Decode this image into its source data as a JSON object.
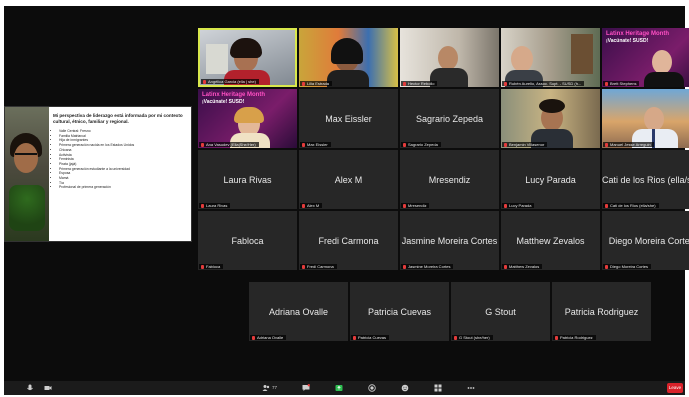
{
  "meeting": {
    "shared_slide": {
      "title": "Mi perspectiva de liderazgo está informada por mi contexto cultural, étnico, familiar y regional.",
      "bullets": [
        "Valle Central: Fresno",
        "Familia Matriarcal",
        "Hija de inmigrantes",
        "Primera generación nacida en los Estados Unidos",
        "Chicana",
        "Activista",
        "Feminista",
        "Pirata (jajá)",
        "Primera generación estudiante a la universidad",
        "Esposa",
        "Mamá",
        "Tía",
        "Profesional de primera generación"
      ]
    },
    "participants": [
      {
        "name": "Angélica Garcia (ella | she)",
        "video": true
      },
      {
        "name": "Lilia Estrada",
        "video": true
      },
      {
        "name": "Hector Rebollo",
        "video": true
      },
      {
        "name": "Rubén Aurelio, Assoc. Supt. - SUSD (h...",
        "video": true
      },
      {
        "name": "Brett Stephens",
        "video": true,
        "banner": "Latinx Heritage Month",
        "banner2": "¡Vacúnate! SUSD!"
      },
      {
        "name": "Ana Vasudev (Ella|She/Her)",
        "video": true,
        "banner": "Latinx Heritage Month",
        "banner2": "¡Vacúnate! SUSD!"
      },
      {
        "name": "Max Eissler",
        "video": false
      },
      {
        "name": "Sagrario Zepeda",
        "video": false
      },
      {
        "name": "Benjamin Villasenor",
        "video": true
      },
      {
        "name": "Manuel Jesse Arreguin",
        "video": true
      },
      {
        "name": "Laura Rivas",
        "video": false
      },
      {
        "name": "Alex M",
        "video": false
      },
      {
        "name": "Mresendiz",
        "video": false
      },
      {
        "name": "Lucy Parada",
        "video": false
      },
      {
        "name": "Cati de los Rios (ella/she/her)",
        "display": "Cati de los Rios (ella/she",
        "label": "Cati de los Rios (ella/she)",
        "video": false
      },
      {
        "name": "Fabloca",
        "video": false
      },
      {
        "name": "Fredi Carmona",
        "video": false
      },
      {
        "name": "Jasmine Moreira Cortes",
        "video": false
      },
      {
        "name": "Matthew Zevalos",
        "video": false
      },
      {
        "name": "Diego Moreira Cortes",
        "video": false
      },
      {
        "name": "Adriana Ovalle",
        "video": false
      },
      {
        "name": "Patricia Cuevas",
        "video": false
      },
      {
        "name": "G Stout",
        "label": "G Stout (she/her)",
        "video": false
      },
      {
        "name": "Patricia Rodriguez",
        "video": false
      }
    ],
    "toolbar": {
      "participant_count": "77",
      "end_label": "Leave"
    },
    "colors": {
      "speaking_border": "#d9e84c",
      "muted_mic": "#e43b3b",
      "end_button": "#d9222a",
      "banner_pink": "#ff4fc4"
    }
  }
}
